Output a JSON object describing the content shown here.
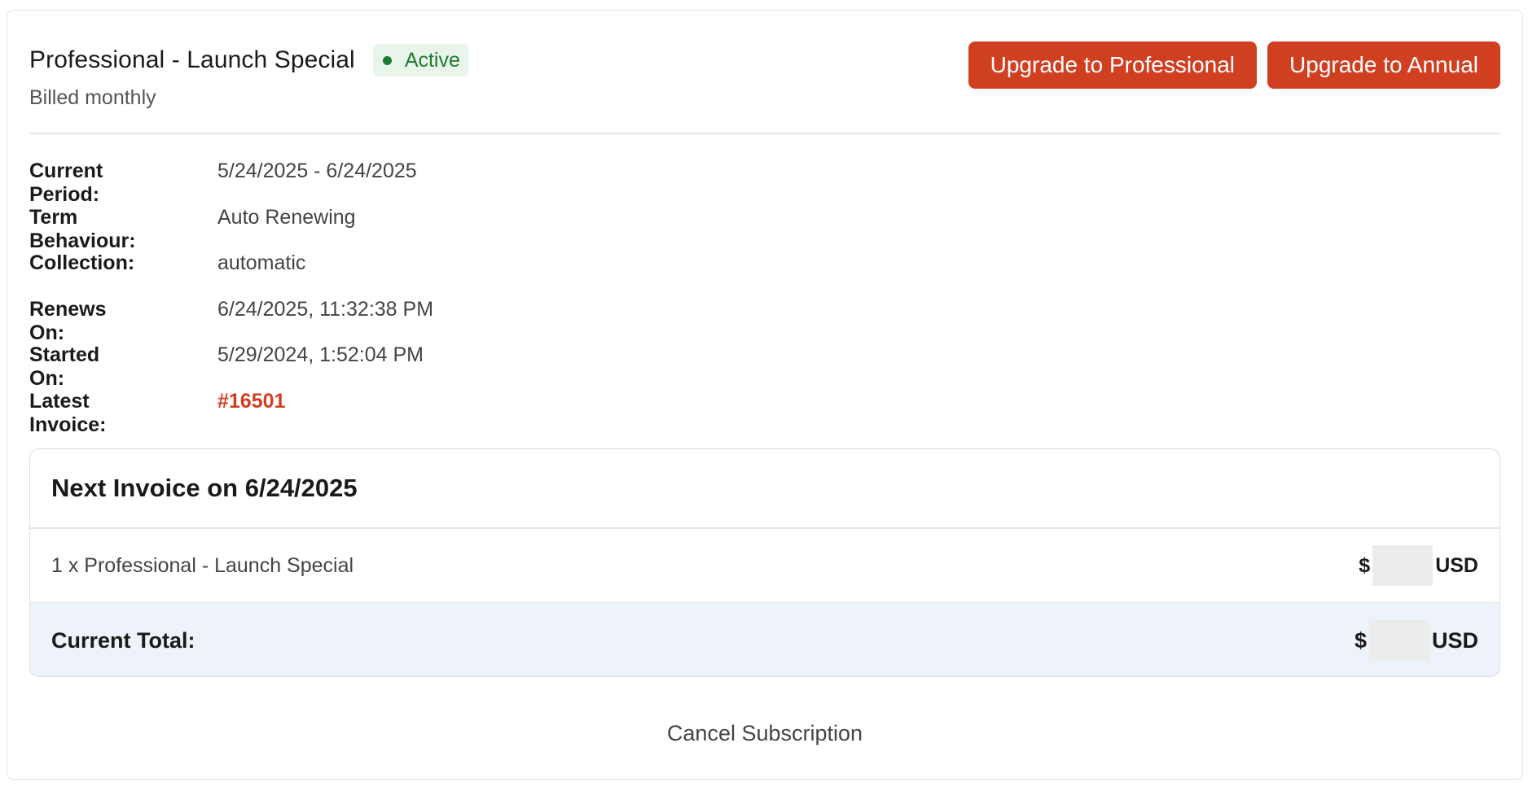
{
  "plan": {
    "title": "Professional - Launch Special",
    "status": "Active",
    "billing_cycle": "Billed monthly"
  },
  "actions": {
    "upgrade_professional": "Upgrade to Professional",
    "upgrade_annual": "Upgrade to Annual"
  },
  "details": [
    {
      "label": "Current Period:",
      "value": "5/24/2025 - 6/24/2025"
    },
    {
      "label": "Term Behaviour:",
      "value": "Auto Renewing"
    },
    {
      "label": "Collection:",
      "value": "automatic"
    },
    {
      "label": "Renews On:",
      "value": "6/24/2025, 11:32:38 PM"
    },
    {
      "label": "Started On:",
      "value": "5/29/2024, 1:52:04 PM"
    },
    {
      "label": "Latest Invoice:",
      "value": "#16501"
    }
  ],
  "next_invoice": {
    "heading": "Next Invoice on 6/24/2025",
    "line_item": {
      "label": "1 x Professional - Launch Special",
      "currency_symbol": "$",
      "currency": "USD"
    },
    "total": {
      "label": "Current Total:",
      "currency_symbol": "$",
      "currency": "USD"
    }
  },
  "cancel_label": "Cancel Subscription",
  "colors": {
    "accent": "#d13f21",
    "status_green": "#1f7a2e",
    "status_bg": "#e9f5ea",
    "total_bg": "#eef2fb"
  }
}
